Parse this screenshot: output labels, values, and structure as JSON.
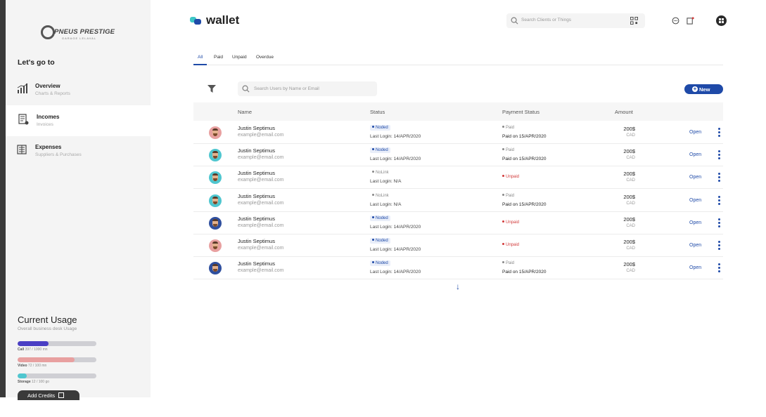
{
  "brand": {
    "name": "PNEUS PRESTIGE",
    "tagline": "GARAGE LELAVAL"
  },
  "sidebar": {
    "heading": "Let's go to",
    "items": [
      {
        "title": "Overview",
        "subtitle": "Charts & Reports",
        "icon": "chart-bars-icon",
        "active": false
      },
      {
        "title": "Incomes",
        "subtitle": "Invoices",
        "icon": "invoice-icon",
        "active": true
      },
      {
        "title": "Expenses",
        "subtitle": "Suppliers & Purchases",
        "icon": "expenses-icon",
        "active": false
      }
    ]
  },
  "usage": {
    "title": "Current Usage",
    "subtitle": "Overall business desk Usage",
    "bars": [
      {
        "name": "Call",
        "text": "397 / 1000 mn",
        "fraction": 0.397,
        "color": "#4a3fc4"
      },
      {
        "name": "Video",
        "text": "72 / 100 mn",
        "fraction": 0.72,
        "color": "#e8a0a0"
      },
      {
        "name": "Storage",
        "text": "12 / 100 go",
        "fraction": 0.12,
        "color": "#4fc6cf"
      }
    ],
    "add_credits_label": "Add Credits"
  },
  "header": {
    "title": "wallet",
    "search_placeholder": "Search Clients or Things"
  },
  "tabs": [
    "All",
    "Paid",
    "Unpaid",
    "Overdue"
  ],
  "toolbar": {
    "search_placeholder": "Search Users by Name or Email",
    "new_label": "New"
  },
  "table": {
    "columns": {
      "name": "Name",
      "status": "Status",
      "payment": "Payment Status",
      "amount": "Amount"
    },
    "rows": [
      {
        "name": "Justin Septimus",
        "email": "example@email.com",
        "status": "Noded",
        "last_login": "Last Login: 14/APR/2020",
        "payment": "Paid",
        "paid_on": "Paid on 15/APR/2020",
        "amount": "200$",
        "currency": "CAD",
        "action": "Open",
        "avatar_bg": "#e8a0a0"
      },
      {
        "name": "Justin Septimus",
        "email": "example@email.com",
        "status": "Noded",
        "last_login": "Last Login: 14/APR/2020",
        "payment": "Paid",
        "paid_on": "Paid on 15/APR/2020",
        "amount": "200$",
        "currency": "CAD",
        "action": "Open",
        "avatar_bg": "#4fc6cf"
      },
      {
        "name": "Justin Septimus",
        "email": "example@email.com",
        "status": "NoLink",
        "last_login": "Last Login: N/A",
        "payment": "Unpaid",
        "paid_on": "",
        "amount": "200$",
        "currency": "CAD",
        "action": "Open",
        "avatar_bg": "#4fc6cf"
      },
      {
        "name": "Justin Septimus",
        "email": "example@email.com",
        "status": "NoLink",
        "last_login": "Last Login: N/A",
        "payment": "Paid",
        "paid_on": "Paid on 15/APR/2020",
        "amount": "200$",
        "currency": "CAD",
        "action": "Open",
        "avatar_bg": "#4fc6cf"
      },
      {
        "name": "Justin Septimus",
        "email": "example@email.com",
        "status": "Noded",
        "last_login": "Last Login: 14/APR/2020",
        "payment": "Unpaid",
        "paid_on": "",
        "amount": "200$",
        "currency": "CAD",
        "action": "Open",
        "avatar_bg": "#2f4f9e"
      },
      {
        "name": "Justin Septimus",
        "email": "example@email.com",
        "status": "Noded",
        "last_login": "Last Login: 14/APR/2020",
        "payment": "Unpaid",
        "paid_on": "",
        "amount": "200$",
        "currency": "CAD",
        "action": "Open",
        "avatar_bg": "#e8a0a0"
      },
      {
        "name": "Justin Septimus",
        "email": "example@email.com",
        "status": "Noded",
        "last_login": "Last Login: 14/APR/2020",
        "payment": "Paid",
        "paid_on": "Paid on 15/APR/2020",
        "amount": "200$",
        "currency": "CAD",
        "action": "Open",
        "avatar_bg": "#2f4f9e"
      }
    ]
  },
  "colors": {
    "accent": "#1f4aa8",
    "unpaid": "#d23b3b",
    "sidebar_bg": "#f4f4f4"
  }
}
